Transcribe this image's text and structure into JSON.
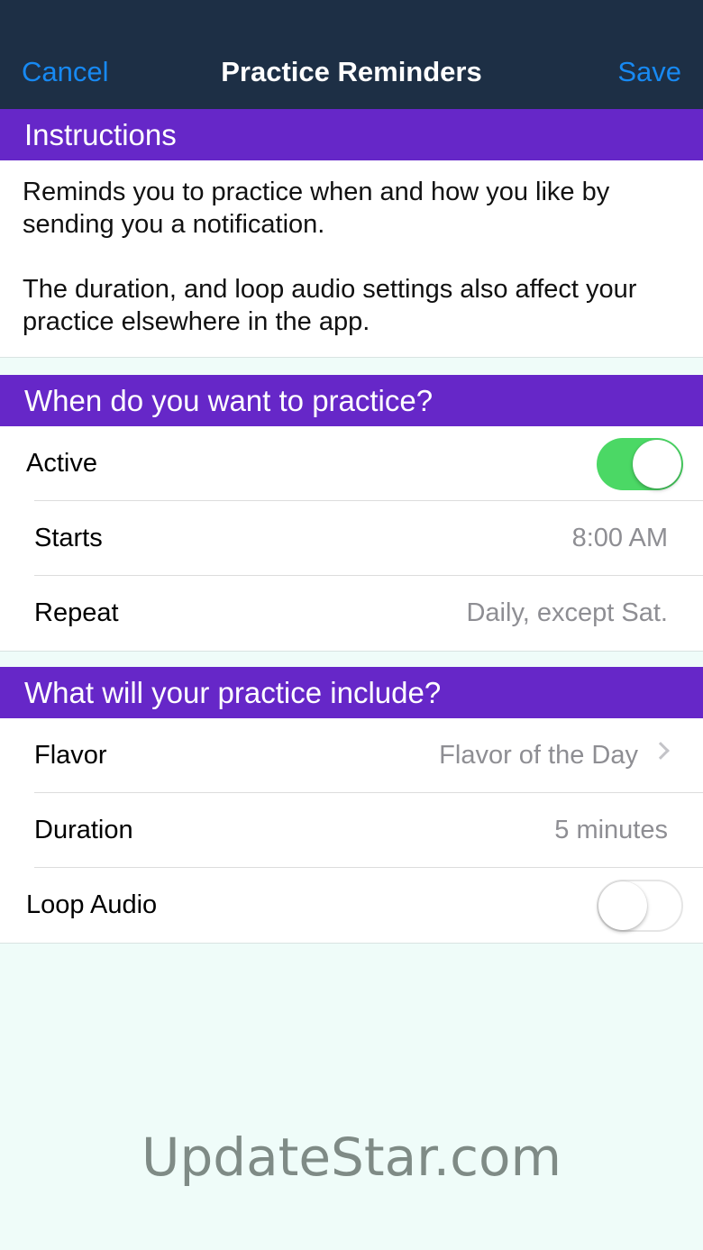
{
  "navbar": {
    "cancel_label": "Cancel",
    "title": "Practice Reminders",
    "save_label": "Save"
  },
  "instructions": {
    "header": "Instructions",
    "paragraph1": "Reminds you to practice when and how you like by sending you a notification.",
    "paragraph2": "The duration, and loop audio settings also affect your practice elsewhere in the app."
  },
  "schedule": {
    "header": "When do you want to practice?",
    "active_label": "Active",
    "active_on": true,
    "starts_label": "Starts",
    "starts_value": "8:00 AM",
    "repeat_label": "Repeat",
    "repeat_value": "Daily, except Sat."
  },
  "content": {
    "header": "What will your practice include?",
    "flavor_label": "Flavor",
    "flavor_value": "Flavor of the Day",
    "duration_label": "Duration",
    "duration_value": "5 minutes",
    "loop_audio_label": "Loop Audio",
    "loop_audio_on": false
  },
  "watermark": "UpdateStar.com",
  "colors": {
    "navbar_bg": "#1d2f45",
    "nav_button": "#1789f2",
    "section_header_bg": "#6627c8",
    "toggle_on": "#4bd865",
    "page_bg": "#effcf9",
    "secondary_text": "#8e8e93"
  }
}
